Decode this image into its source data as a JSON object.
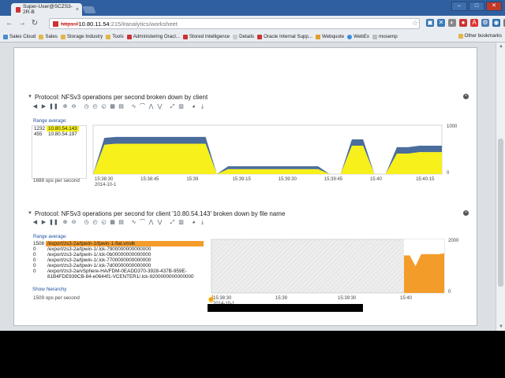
{
  "browser": {
    "tab_title": "Super-User@SCZS3-2R-B",
    "url_scheme": "https://",
    "url_host": "10.80.11.54",
    "url_path": ":215/#analytics/worksheet",
    "bookmarks": [
      "Sales Cloud",
      "Sales",
      "Storage Industry",
      "Tools",
      "Administering Oracl...",
      "Stored Intelligence",
      "Details",
      "Oracle Internal Supp...",
      "Webquote",
      "WebEx",
      "mosemp"
    ],
    "other_bookmarks": "Other bookmarks"
  },
  "panel1": {
    "title": "Protocol: NFSv3 operations per second broken down by client",
    "range_label": "Range average:",
    "legend": [
      {
        "value": "1232",
        "label": "10.80.54.143"
      },
      {
        "value": "455",
        "label": "10.80.54.197"
      }
    ],
    "ops_total": "1688 ops per second",
    "colors": {
      "yellow": "#f7f01a",
      "blue": "#4a6d9c"
    }
  },
  "panel2": {
    "title": "Protocol: NFSv3 operations per second for client '10.80.54.143' broken down by file name",
    "range_label": "Range average:",
    "legend": [
      {
        "value": "1508",
        "label": "/export/zs3-2a/tpwin-1/tpwin-1-flat.vmdk",
        "selected": true
      },
      {
        "value": "0",
        "label": "/export/zs3-2a/tpwin-1/.lck-7900000000000000"
      },
      {
        "value": "0",
        "label": "/export/zs3-2a/tpwin-1/.lck-0b00000000000000"
      },
      {
        "value": "0",
        "label": "/export/zs3-2a/tpwin-1/.lck-7700000000000000"
      },
      {
        "value": "0",
        "label": "/export/zs3-2a/tpwin-1/.lck-7d00000000000000"
      },
      {
        "value": "0",
        "label": "/export/zs3-2a/vSphere-HA/FDM-0EADD370-3928-437B-959E-"
      },
      {
        "value": "",
        "label": "81B4FDE939CB-84-e0644f1-VCENTER1/.lck-9200000000000000"
      }
    ],
    "show_hierarchy": "Show hierarchy",
    "ops_total": "1509 ops per second",
    "colors": {
      "orange": "#f39c2a",
      "selected_bg": "#f39c2a"
    }
  },
  "chart_data": [
    {
      "type": "area",
      "title": "Protocol: NFSv3 operations per second broken down by client",
      "x_ticks": [
        "15:38:30",
        "15:38:45",
        "15:39",
        "15:39:15",
        "15:39:30",
        "15:39:45",
        "15:40",
        "15:40:15"
      ],
      "x_date": "2014-10-1",
      "y_ticks": [
        "1000",
        "0"
      ],
      "ylim": [
        0,
        1000
      ],
      "series": [
        {
          "name": "10.80.54.143",
          "color": "#f7f01a",
          "values": [
            0,
            600,
            620,
            620,
            620,
            620,
            620,
            620,
            620,
            620,
            620,
            0,
            100,
            100,
            100,
            100,
            100,
            100,
            100,
            100,
            100,
            0,
            0,
            580,
            580,
            0,
            0,
            420,
            420,
            450,
            450,
            450
          ]
        },
        {
          "name": "10.80.54.197",
          "color": "#4a6d9c",
          "values": [
            0,
            140,
            140,
            140,
            140,
            140,
            140,
            140,
            140,
            140,
            140,
            0,
            60,
            60,
            60,
            60,
            60,
            60,
            60,
            60,
            60,
            0,
            0,
            130,
            130,
            0,
            0,
            130,
            130,
            130,
            130,
            130
          ]
        }
      ]
    },
    {
      "type": "area",
      "title": "Protocol: NFSv3 operations per second for client '10.80.54.143' broken down by file name",
      "x_ticks": [
        "15:38:30",
        "15:39",
        "15:39:30",
        "15:40"
      ],
      "x_date": "2014-10-1",
      "y_ticks": [
        "2000",
        "0"
      ],
      "ylim": [
        0,
        2000
      ],
      "series": [
        {
          "name": "/export/zs3-2a/tpwin-1/tpwin-1-flat.vmdk",
          "color": "#f39c2a",
          "values": [
            1400,
            1400,
            1000,
            1450,
            1450,
            1450,
            1450,
            1480
          ]
        }
      ]
    }
  ]
}
